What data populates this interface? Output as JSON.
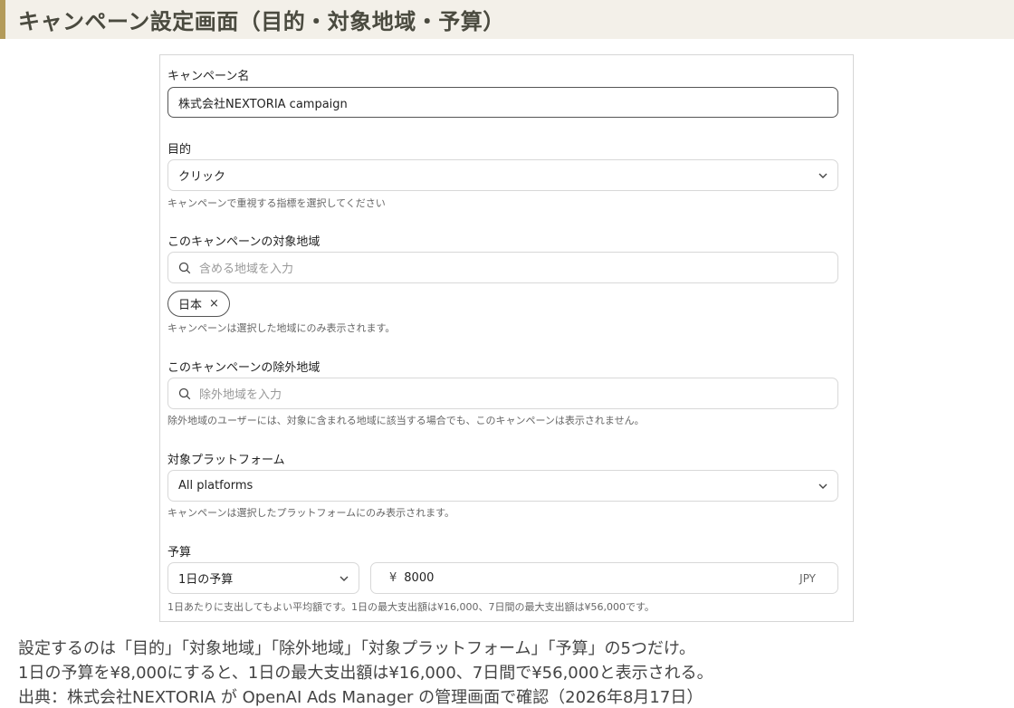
{
  "header": {
    "title": "キャンペーン設定画面（目的・対象地域・予算）"
  },
  "form": {
    "campaign_name": {
      "label": "キャンペーン名",
      "value": "株式会社NEXTORIA campaign"
    },
    "objective": {
      "label": "目的",
      "value": "クリック",
      "help": "キャンペーンで重視する指標を選択してください"
    },
    "target_region": {
      "label": "このキャンペーンの対象地域",
      "placeholder": "含める地域を入力",
      "chip": "日本",
      "chip_remove": "×",
      "help": "キャンペーンは選択した地域にのみ表示されます。"
    },
    "excluded_region": {
      "label": "このキャンペーンの除外地域",
      "placeholder": "除外地域を入力",
      "help": "除外地域のユーザーには、対象に含まれる地域に該当する場合でも、このキャンペーンは表示されません。"
    },
    "platform": {
      "label": "対象プラットフォーム",
      "value": "All platforms",
      "help": "キャンペーンは選択したプラットフォームにのみ表示されます。"
    },
    "budget": {
      "label": "予算",
      "type": "1日の予算",
      "currency_symbol": "¥",
      "amount": "8000",
      "currency": "JPY",
      "help": "1日あたりに支出してもよい平均額です。1日の最大支出額は¥16,000、7日間の最大支出額は¥56,000です。"
    }
  },
  "notes": [
    "設定するのは「目的」「対象地域」「除外地域」「対象プラットフォーム」「予算」の5つだけ。",
    "1日の予算を¥8,000にすると、1日の最大支出額は¥16,000、7日間で¥56,000と表示される。",
    "出典：株式会社NEXTORIA が OpenAI Ads Manager の管理画面で確認（2026年8月17日）"
  ],
  "colors": {
    "accent": "#b39b5a",
    "header_bg": "#f3f0e9"
  },
  "icons": {
    "dropdown": "chevron-down-icon",
    "search": "search-icon",
    "remove": "close-icon"
  }
}
